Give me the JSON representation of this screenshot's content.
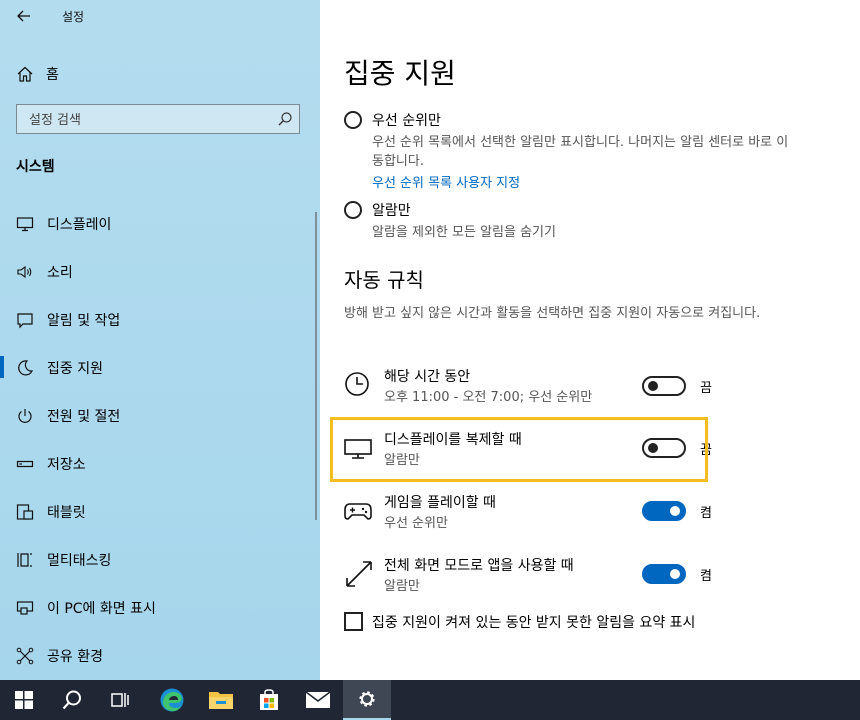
{
  "app": {
    "title": "설정"
  },
  "sidebar": {
    "home_label": "홈",
    "search_placeholder": "설정 검색",
    "section": "시스템",
    "items": [
      {
        "label": "디스플레이",
        "icon": "monitor-icon"
      },
      {
        "label": "소리",
        "icon": "speaker-icon"
      },
      {
        "label": "알림 및 작업",
        "icon": "message-icon"
      },
      {
        "label": "집중 지원",
        "icon": "moon-icon",
        "active": true
      },
      {
        "label": "전원 및 절전",
        "icon": "power-icon"
      },
      {
        "label": "저장소",
        "icon": "storage-icon"
      },
      {
        "label": "태블릿",
        "icon": "tablet-icon"
      },
      {
        "label": "멀티태스킹",
        "icon": "multitask-icon"
      },
      {
        "label": "이 PC에 화면 표시",
        "icon": "project-icon"
      },
      {
        "label": "공유 환경",
        "icon": "share-icon"
      }
    ]
  },
  "main": {
    "title": "집중 지원",
    "options": [
      {
        "label": "우선 순위만",
        "desc": "우선 순위 목록에서 선택한 알림만 표시합니다. 나머지는 알림 센터로 바로 이동합니다.",
        "link": "우선 순위 목록 사용자 지정"
      },
      {
        "label": "알람만",
        "desc": "알람을 제외한 모든 알림을 숨기기"
      }
    ],
    "auto_rules_title": "자동 규칙",
    "auto_rules_desc": "방해 받고 싶지 않은 시간과 활동을 선택하면 집중 지원이 자동으로 켜집니다.",
    "rules": [
      {
        "title": "해당 시간 동안",
        "subtitle": "오후 11:00 - 오전 7:00; 우선 순위만",
        "state": "끔",
        "on": false,
        "icon": "clock-icon"
      },
      {
        "title": "디스플레이를 복제할 때",
        "subtitle": "알람만",
        "state": "끔",
        "on": false,
        "icon": "monitor-icon"
      },
      {
        "title": "게임을 플레이할 때",
        "subtitle": "우선 순위만",
        "state": "켬",
        "on": true,
        "icon": "gamepad-icon"
      },
      {
        "title": "전체 화면 모드로 앱을 사용할 때",
        "subtitle": "알람만",
        "state": "켬",
        "on": true,
        "icon": "fullscreen-icon"
      }
    ],
    "summary_checkbox": "집중 지원이 켜져 있는 동안 받지 못한 알림을 요약 표시"
  },
  "taskbar": {
    "items": [
      "windows-start-icon",
      "search-icon",
      "task-view-icon",
      "edge-icon",
      "file-explorer-icon",
      "store-icon",
      "mail-icon",
      "settings-icon"
    ]
  },
  "colors": {
    "accent": "#0067c0",
    "sidebar_bg": "#a6d6ec",
    "highlight": "#f5bd1f",
    "taskbar": "#202633"
  }
}
